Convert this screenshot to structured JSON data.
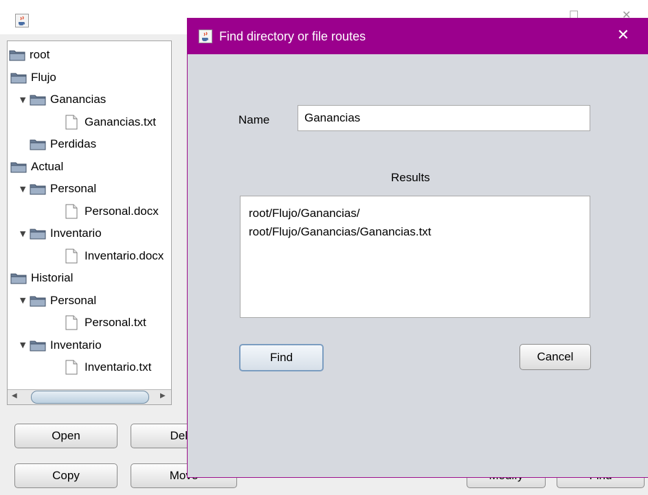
{
  "main_window": {
    "tree": [
      {
        "label": "root",
        "type": "folder",
        "depth": 0,
        "toggle": ""
      },
      {
        "label": "Flujo",
        "type": "folder",
        "depth": 1,
        "toggle": "▼"
      },
      {
        "label": "Ganancias",
        "type": "folder",
        "depth": 2,
        "toggle": "▼"
      },
      {
        "label": "Ganancias.txt",
        "type": "file",
        "depth": 3,
        "toggle": ""
      },
      {
        "label": "Perdidas",
        "type": "folder",
        "depth": 2,
        "toggle": ""
      },
      {
        "label": "Actual",
        "type": "folder",
        "depth": 1,
        "toggle": "▼"
      },
      {
        "label": "Personal",
        "type": "folder",
        "depth": 2,
        "toggle": "▼"
      },
      {
        "label": "Personal.docx",
        "type": "file",
        "depth": 3,
        "toggle": ""
      },
      {
        "label": "Inventario",
        "type": "folder",
        "depth": 2,
        "toggle": "▼"
      },
      {
        "label": "Inventario.docx",
        "type": "file",
        "depth": 3,
        "toggle": ""
      },
      {
        "label": "Historial",
        "type": "folder",
        "depth": 1,
        "toggle": "▼"
      },
      {
        "label": "Personal",
        "type": "folder",
        "depth": 2,
        "toggle": "▼"
      },
      {
        "label": "Personal.txt",
        "type": "file",
        "depth": 3,
        "toggle": ""
      },
      {
        "label": "Inventario",
        "type": "folder",
        "depth": 2,
        "toggle": "▼"
      },
      {
        "label": "Inventario.txt",
        "type": "file",
        "depth": 3,
        "toggle": ""
      }
    ],
    "buttons": {
      "open": "Open",
      "delete": "Dele",
      "copy": "Copy",
      "move": "Move",
      "modify": "Modify",
      "find": "Find"
    },
    "window_controls": {
      "maximize": "☐",
      "close": "✕"
    }
  },
  "dialog": {
    "title": "Find directory or file routes",
    "close_glyph": "✕",
    "name_label": "Name",
    "name_value": "Ganancias",
    "results_label": "Results",
    "results": [
      "root/Flujo/Ganancias/",
      "root/Flujo/Ganancias/Ganancias.txt"
    ],
    "find_button": "Find",
    "cancel_button": "Cancel"
  },
  "icons": {
    "app": "java-coffee-icon",
    "folder": "folder-icon",
    "file": "file-icon"
  },
  "colors": {
    "dialog_titlebar": "#9b008d",
    "dialog_body": "#d6d9df",
    "main_body": "#eeeeee"
  }
}
